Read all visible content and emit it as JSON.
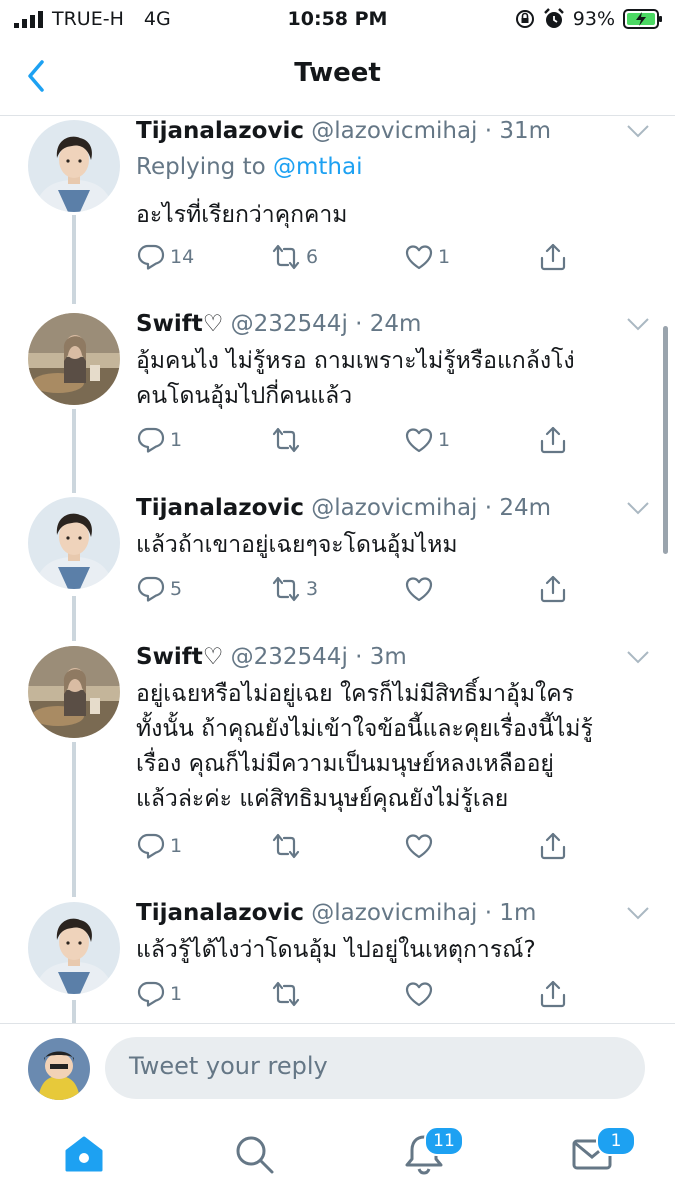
{
  "status_bar": {
    "carrier": "TRUE-H",
    "network": "4G",
    "time": "10:58 PM",
    "battery": "93%"
  },
  "nav": {
    "title": "Tweet",
    "back_icon": "chevron-left-icon"
  },
  "tweets": [
    {
      "name": "Tijanalazovic",
      "handle": "@lazovicmihaj",
      "time": "· 31m",
      "reply_prefix": "Replying to",
      "reply_mention": "@mthai",
      "lines": [
        "อะไรที่เรียกว่าคุกคาม"
      ],
      "replies": "14",
      "retweets": "6",
      "likes": "1"
    },
    {
      "name": "Swift♡",
      "handle": "@232544j",
      "time": "· 24m",
      "lines": [
        "อุ้มคนไง ไม่รู้หรอ ถามเพราะไม่รู้หรือแกล้งโง่",
        "คนโดนอุ้มไปกี่คนแล้ว"
      ],
      "replies": "1",
      "retweets": "",
      "likes": "1"
    },
    {
      "name": "Tijanalazovic",
      "handle": "@lazovicmihaj",
      "time": "· 24m",
      "lines": [
        "แล้วถ้าเขาอยู่เฉยๆจะโดนอุ้มไหม"
      ],
      "replies": "5",
      "retweets": "3",
      "likes": ""
    },
    {
      "name": "Swift♡",
      "handle": "@232544j",
      "time": "· 3m",
      "lines": [
        "อยู่เฉยหรือไม่อยู่เฉย ใครก็ไม่มีสิทธิ์มาอุ้มใคร",
        "ทั้งนั้น ถ้าคุณยังไม่เข้าใจข้อนี้และคุยเรื่องนี้ไม่รู้",
        "เรื่อง คุณก็ไม่มีความเป็นมนุษย์หลงเหลืออยู่",
        "แล้วล่ะค่ะ แค่สิทธิมนุษย์คุณยังไม่รู้เลย"
      ],
      "replies": "1",
      "retweets": "",
      "likes": ""
    },
    {
      "name": "Tijanalazovic",
      "handle": "@lazovicmihaj",
      "time": "· 1m",
      "lines": [
        "แล้วรู้ได้ไงว่าโดนอุ้ม ไปอยู่ในเหตุการณ์?"
      ],
      "replies": "1",
      "retweets": "",
      "likes": ""
    }
  ],
  "reply_box": {
    "placeholder": "Tweet your reply"
  },
  "tab_bar": {
    "notifications_badge": "11",
    "messages_badge": "1"
  },
  "colors": {
    "accent": "#1da1f2",
    "secondary_text": "#657786",
    "divider": "#ccd6dd"
  }
}
